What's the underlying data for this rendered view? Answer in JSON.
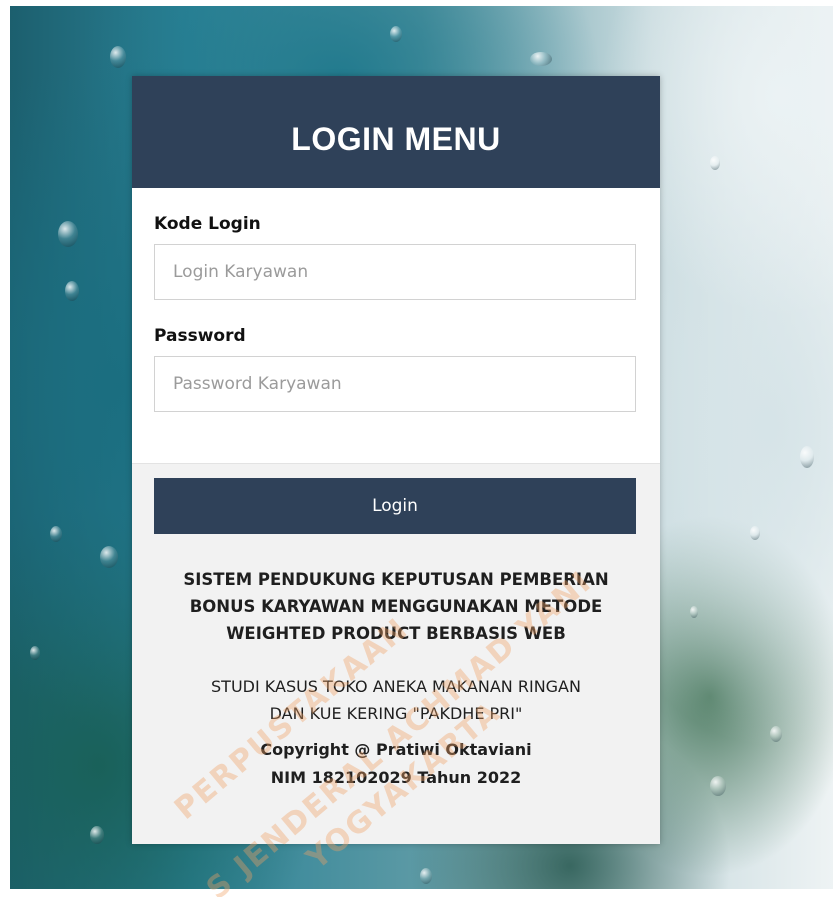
{
  "header": {
    "title": "LOGIN MENU"
  },
  "form": {
    "kode_login": {
      "label": "Kode Login",
      "placeholder": "Login Karyawan",
      "value": ""
    },
    "password": {
      "label": "Password",
      "placeholder": "Password Karyawan",
      "value": ""
    },
    "login_button": "Login"
  },
  "info": {
    "system_title_lines": [
      "SISTEM PENDUKUNG KEPUTUSAN PEMBERIAN",
      "BONUS KARYAWAN MENGGUNAKAN METODE",
      "WEIGHTED PRODUCT BERBASIS WEB"
    ],
    "study_case_lines": [
      "STUDI KASUS TOKO ANEKA MAKANAN RINGAN",
      "DAN KUE KERING \"PAKDHE PRI\""
    ],
    "copyright_lines": [
      "Copyright @ Pratiwi Oktaviani",
      "NIM 182102029 Tahun 2022"
    ]
  },
  "watermark_lines": [
    "PERPUSTAKAAN",
    "S JENDERAL ACHMAD YANI",
    "YOGYAKARTA"
  ],
  "colors": {
    "header_bg": "#2f4159",
    "button_bg": "#2f4159",
    "card_bg": "#f2f2f2",
    "watermark": "#f0a064"
  }
}
